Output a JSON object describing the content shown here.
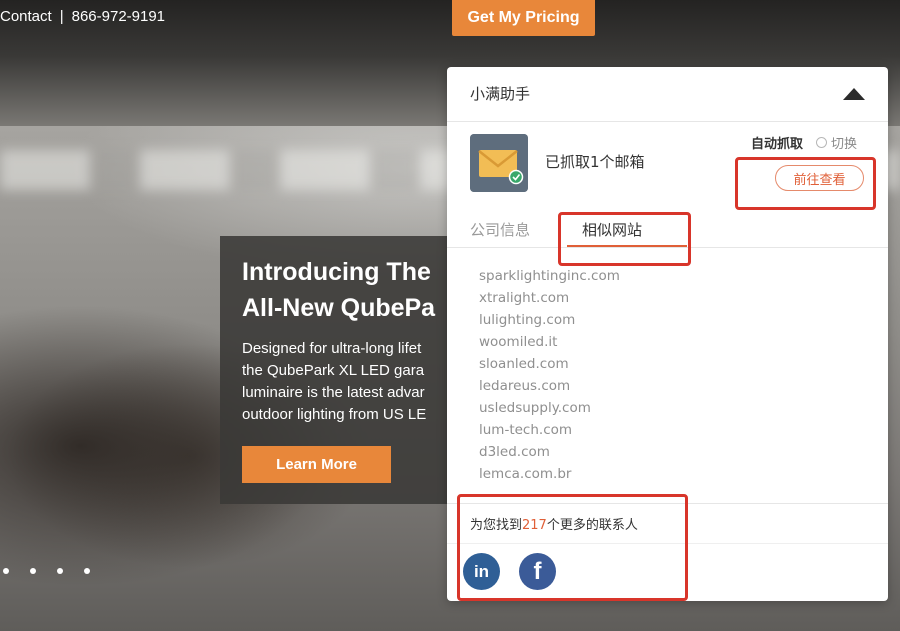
{
  "website": {
    "contact_label": "Contact",
    "separator": "|",
    "phone": "866-972-9191",
    "pricing_button": "Get My Pricing",
    "promo": {
      "title_line1": "Introducing The",
      "title_line2": "All-New QubePa",
      "body_lines": [
        "Designed for ultra-long lifet",
        "the QubePark XL LED gara",
        "luminaire is the latest advar",
        "outdoor lighting from US LE"
      ],
      "learn_more": "Learn More"
    },
    "carousel_dots": 4
  },
  "panel": {
    "title": "小满助手",
    "collapse_icon": "triangle-up-icon",
    "email_icon": "envelope-check-icon",
    "email_status": "已抓取1个邮箱",
    "auto_capture": "自动抓取",
    "switch_label": "切换",
    "view_button": "前往查看",
    "tabs": [
      {
        "label": "公司信息",
        "active": false
      },
      {
        "label": "相似网站",
        "active": true
      }
    ],
    "similar_sites": [
      "sparklightinginc.com",
      "xtralight.com",
      "lulighting.com",
      "woomiled.it",
      "sloanled.com",
      "ledareus.com",
      "usledsupply.com",
      "lum-tech.com",
      "d3led.com",
      "lemca.com.br"
    ],
    "more_contacts": {
      "prefix": "为您找到",
      "count": "217",
      "suffix": "个更多的联系人"
    },
    "social": [
      {
        "label": "in",
        "icon": "linkedin-icon"
      },
      {
        "label": "f",
        "icon": "facebook-icon"
      }
    ]
  },
  "colors": {
    "accent_orange": "#e8873a",
    "highlight_red": "#d8352a",
    "tab_active": "#e05f37",
    "linkedin": "#2f5f96",
    "facebook": "#3b5b98"
  }
}
